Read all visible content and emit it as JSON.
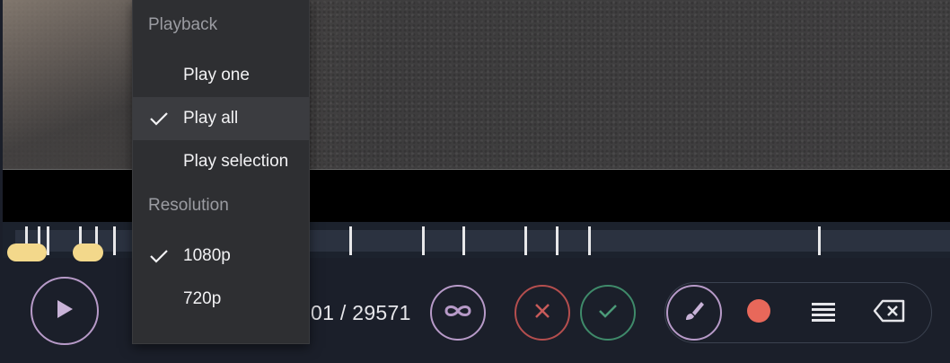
{
  "playback_menu": {
    "playback_header": "Playback",
    "playback_options": [
      {
        "label": "Play one",
        "checked": false
      },
      {
        "label": "Play all",
        "checked": true
      },
      {
        "label": "Play selection",
        "checked": false
      }
    ],
    "resolution_header": "Resolution",
    "resolution_options": [
      {
        "label": "1080p",
        "checked": true
      },
      {
        "label": "720p",
        "checked": false
      }
    ]
  },
  "player": {
    "frame_counter": "01 / 29571"
  },
  "icons": {
    "play": "play-icon",
    "loop": "loop-icon",
    "reject": "close-icon",
    "accept": "check-icon",
    "brush": "brush-icon",
    "record": "record-dot-icon",
    "lines": "lines-icon",
    "backspace": "backspace-icon"
  },
  "colors": {
    "accent_purple": "#b79ac8",
    "reject_red": "#b44e4e",
    "accept_green": "#3f8a6a",
    "record_red": "#e8685a",
    "marker_yellow": "#f3d88b"
  }
}
